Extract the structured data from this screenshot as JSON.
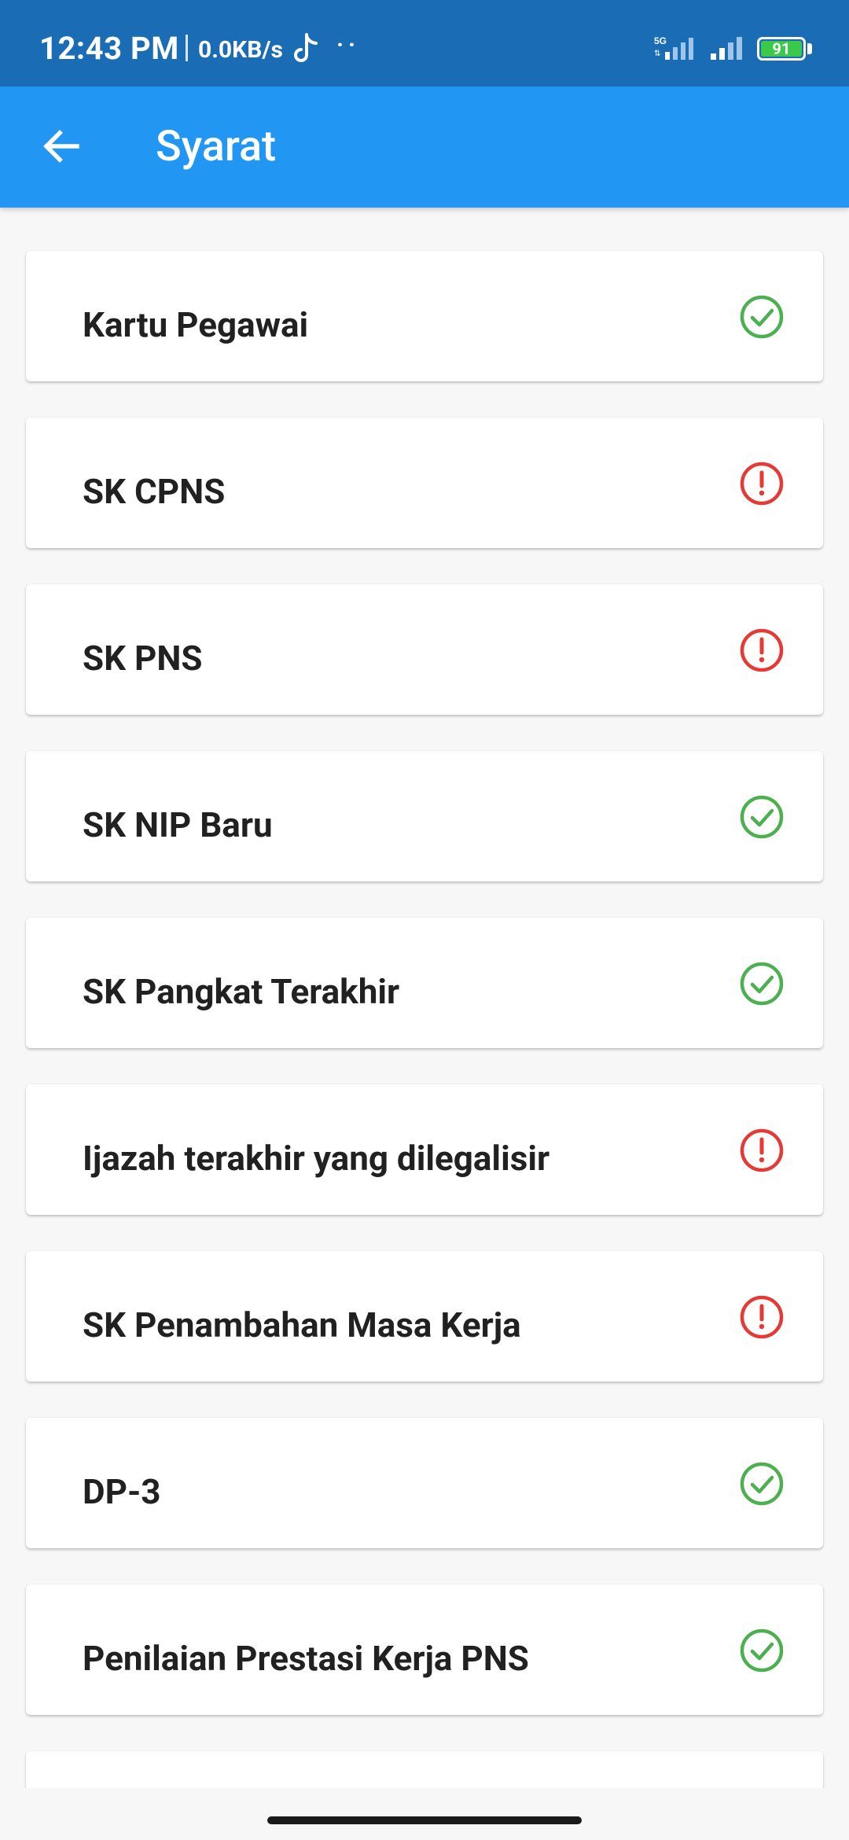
{
  "status_bar": {
    "time": "12:43 PM",
    "network_speed": "0.0KB/s",
    "dots": "··",
    "battery_level": "91",
    "network_type": "5G"
  },
  "app_bar": {
    "title": "Syarat",
    "back_icon": "arrow-left-icon"
  },
  "colors": {
    "status_bar": "#1a6db5",
    "app_bar": "#2196f3",
    "complete": "#4caf50",
    "missing": "#e53935",
    "battery_fill": "#3cc84b"
  },
  "requirements": [
    {
      "label": "Kartu Pegawai",
      "status": "complete",
      "icon": "check-circle-icon"
    },
    {
      "label": "SK CPNS",
      "status": "missing",
      "icon": "alert-circle-icon"
    },
    {
      "label": "SK PNS",
      "status": "missing",
      "icon": "alert-circle-icon"
    },
    {
      "label": "SK NIP Baru",
      "status": "complete",
      "icon": "check-circle-icon"
    },
    {
      "label": "SK Pangkat Terakhir",
      "status": "complete",
      "icon": "check-circle-icon"
    },
    {
      "label": "Ijazah terakhir yang dilegalisir",
      "status": "missing",
      "icon": "alert-circle-icon"
    },
    {
      "label": "SK Penambahan Masa Kerja",
      "status": "missing",
      "icon": "alert-circle-icon"
    },
    {
      "label": "DP-3",
      "status": "complete",
      "icon": "check-circle-icon"
    },
    {
      "label": "Penilaian Prestasi Kerja PNS",
      "status": "complete",
      "icon": "check-circle-icon"
    },
    {
      "label": "",
      "status": "",
      "icon": ""
    }
  ]
}
